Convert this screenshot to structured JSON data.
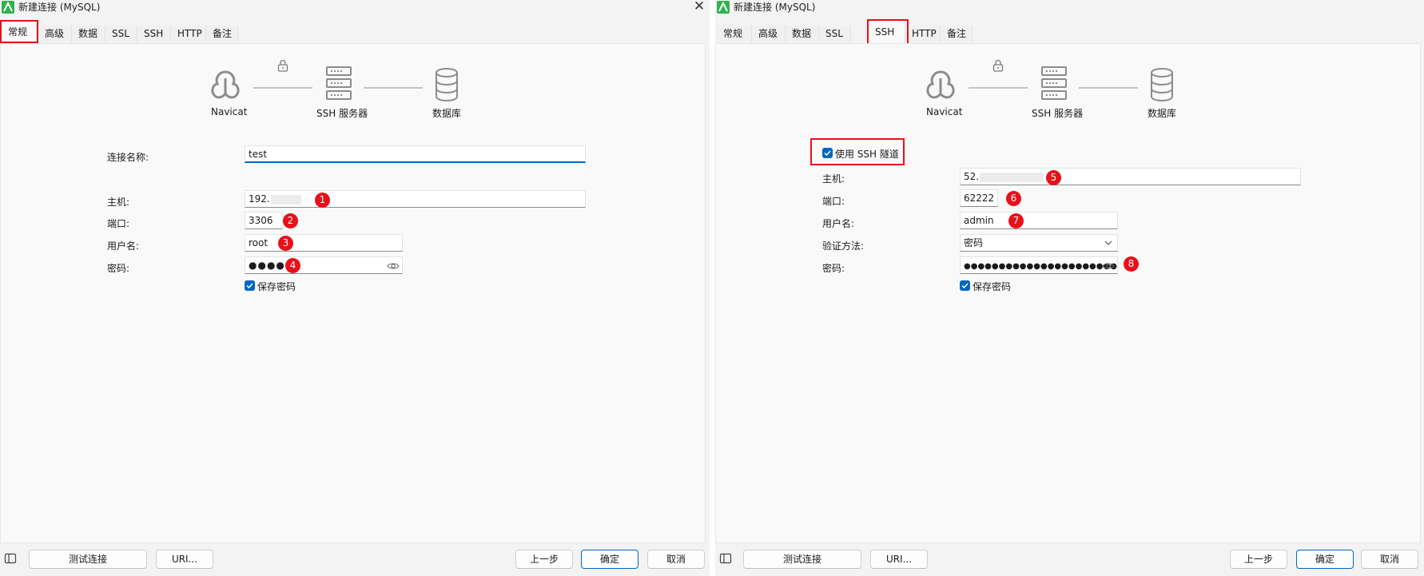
{
  "windows": [
    {
      "title": "新建连接 (MySQL)",
      "tabs": [
        "常规",
        "高级",
        "数据库",
        "SSL",
        "SSH",
        "HTTP",
        "备注"
      ],
      "active_tab": "常规",
      "diagram": {
        "left": "Navicat",
        "middle": "SSH 服务器",
        "right": "数据库"
      },
      "form": {
        "conn_name_label": "连接名称:",
        "conn_name_value": "test",
        "host_label": "主机:",
        "host_value": "192.",
        "port_label": "端口:",
        "port_value": "3306",
        "user_label": "用户名:",
        "user_value": "root",
        "password_label": "密码:",
        "password_value": "●●●●●",
        "save_password_label": "保存密码"
      },
      "badges": [
        "1",
        "2",
        "3",
        "4"
      ],
      "buttons": {
        "test": "测试连接",
        "uri": "URI...",
        "prev": "上一步",
        "ok": "确定",
        "cancel": "取消"
      }
    },
    {
      "title": "新建连接 (MySQL)",
      "tabs": [
        "常规",
        "高级",
        "数据库",
        "SSL",
        "SSH",
        "HTTP",
        "备注"
      ],
      "active_tab": "SSH",
      "diagram": {
        "left": "Navicat",
        "middle": "SSH 服务器",
        "right": "数据库"
      },
      "form": {
        "use_ssh_label": "使用 SSH 隧道",
        "host_label": "主机:",
        "host_value": "52.",
        "port_label": "端口:",
        "port_value": "62222",
        "user_label": "用户名:",
        "user_value": "admin",
        "auth_label": "验证方法:",
        "auth_value": "密码",
        "password_label": "密码:",
        "password_value": "●●●●●●●●●●●●●●●●●●●●●●●●",
        "save_password_label": "保存密码"
      },
      "badges": [
        "5",
        "6",
        "7",
        "8"
      ],
      "buttons": {
        "test": "测试连接",
        "uri": "URI...",
        "prev": "上一步",
        "ok": "确定",
        "cancel": "取消"
      }
    }
  ],
  "colors": {
    "accent": "#0067c0",
    "highlight": "#e8101a",
    "navicat_green": "#2fb24f"
  },
  "icons": [
    "navicat-logo-icon",
    "close-icon",
    "navicat-seal-icon",
    "lock-icon",
    "server-icon",
    "database-icon",
    "eye-icon",
    "chevron-down-icon",
    "checkbox-checked-icon",
    "sidebar-toggle-icon"
  ]
}
